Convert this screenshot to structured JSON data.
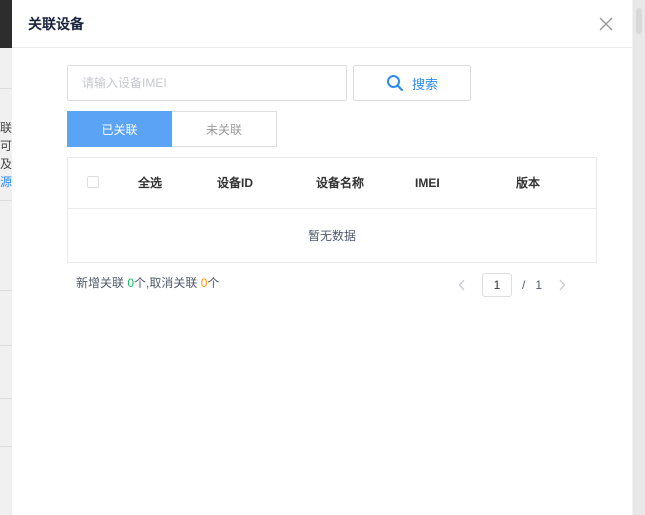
{
  "modal": {
    "title": "关联设备"
  },
  "search": {
    "placeholder": "请输入设备IMEI",
    "value": "",
    "button_label": "搜索"
  },
  "tabs": [
    {
      "label": "已关联",
      "active": true
    },
    {
      "label": "未关联",
      "active": false
    }
  ],
  "table": {
    "select_all_label": "全选",
    "columns": [
      "设备ID",
      "设备名称",
      "IMEI",
      "版本"
    ],
    "empty_text": "暂无数据"
  },
  "status": {
    "added_prefix": "新增关联 ",
    "added_count": "0",
    "added_suffix": "个,取消关联 ",
    "removed_count": "0",
    "removed_suffix": "个"
  },
  "pagination": {
    "current_page": "1",
    "separator": "/",
    "total_pages": "1"
  },
  "colors": {
    "accent": "#2d8cf0",
    "active_tab": "#5ba3f5",
    "added_count": "#19be6b",
    "removed_count": "#ff9900"
  },
  "icons": {
    "close": "close-icon",
    "search": "search-icon",
    "prev": "chevron-left-icon",
    "next": "chevron-right-icon"
  }
}
